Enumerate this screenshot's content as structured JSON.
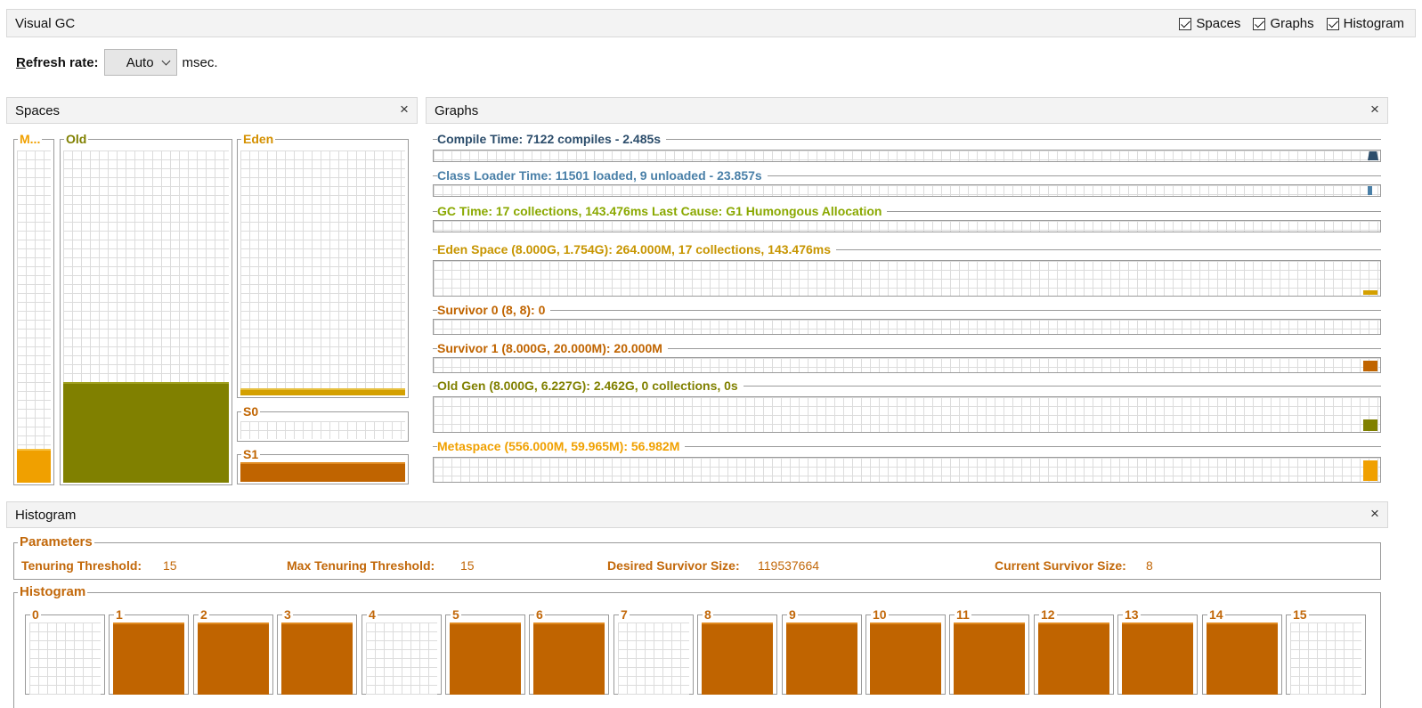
{
  "header": {
    "title": "Visual GC",
    "checks": [
      {
        "label": "Spaces",
        "checked": true
      },
      {
        "label": "Graphs",
        "checked": true
      },
      {
        "label": "Histogram",
        "checked": true
      }
    ]
  },
  "refresh": {
    "label_underlined": "R",
    "label_rest": "efresh rate:",
    "value": "Auto",
    "unit": "msec."
  },
  "spaces": {
    "title": "Spaces",
    "close": "×",
    "metaspace": {
      "label": "M...",
      "fill_fraction": 0.1,
      "color": "#f0a000"
    },
    "old": {
      "label": "Old",
      "fill_fraction": 0.3,
      "color": "#808000"
    },
    "eden": {
      "label": "Eden",
      "fill_fraction": 0.03,
      "color": "#d4a000"
    },
    "s0": {
      "label": "S0",
      "fill_fraction": 0.0
    },
    "s1": {
      "label": "S1",
      "fill_fraction": 1.0,
      "color": "#c06400"
    }
  },
  "graphs": {
    "title": "Graphs",
    "close": "×",
    "rows": [
      {
        "label": "Compile Time: 7122 compiles - 2.485s",
        "color": "#2c4d6b"
      },
      {
        "label": "Class Loader Time: 11501 loaded, 9 unloaded - 23.857s",
        "color": "#4a80a8"
      },
      {
        "label": "GC Time: 17 collections, 143.476ms Last Cause: G1 Humongous Allocation",
        "color": "#8aa800"
      },
      {
        "label": "Eden Space (8.000G, 1.754G): 264.000M, 17 collections, 143.476ms",
        "color": "#c79500"
      },
      {
        "label": "Survivor 0 (8, 8): 0",
        "color": "#c06400"
      },
      {
        "label": "Survivor 1 (8.000G, 20.000M): 20.000M",
        "color": "#c06400"
      },
      {
        "label": "Old Gen (8.000G, 6.227G): 2.462G, 0 collections, 0s",
        "color": "#808000"
      },
      {
        "label": "Metaspace (556.000M, 59.965M): 56.982M",
        "color": "#f0a000"
      }
    ]
  },
  "histogram": {
    "title": "Histogram",
    "close": "×",
    "parameters_title": "Parameters",
    "params": [
      {
        "label": "Tenuring Threshold:",
        "value": "15"
      },
      {
        "label": "Max Tenuring Threshold:",
        "value": "15"
      },
      {
        "label": "Desired Survivor Size:",
        "value": "119537664"
      },
      {
        "label": "Current Survivor Size:",
        "value": "8"
      }
    ],
    "histogram_title": "Histogram",
    "cells": [
      {
        "label": "0",
        "filled": false
      },
      {
        "label": "1",
        "filled": true
      },
      {
        "label": "2",
        "filled": true
      },
      {
        "label": "3",
        "filled": true
      },
      {
        "label": "4",
        "filled": false
      },
      {
        "label": "5",
        "filled": true
      },
      {
        "label": "6",
        "filled": true
      },
      {
        "label": "7",
        "filled": false
      },
      {
        "label": "8",
        "filled": true
      },
      {
        "label": "9",
        "filled": true
      },
      {
        "label": "10",
        "filled": true
      },
      {
        "label": "11",
        "filled": true
      },
      {
        "label": "12",
        "filled": true
      },
      {
        "label": "13",
        "filled": true
      },
      {
        "label": "14",
        "filled": true
      },
      {
        "label": "15",
        "filled": false
      }
    ]
  }
}
